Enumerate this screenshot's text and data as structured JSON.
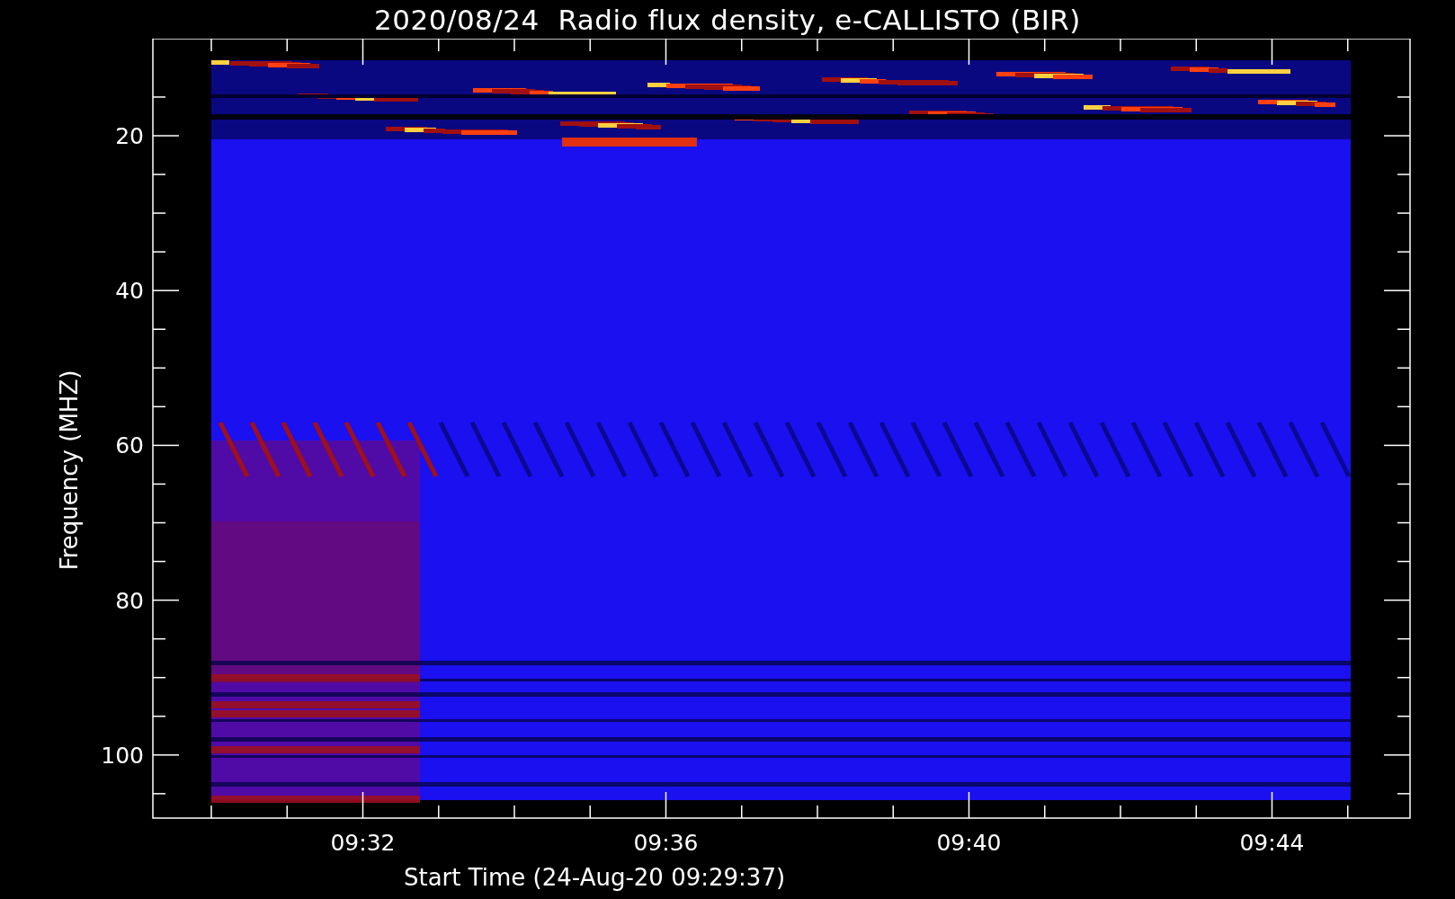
{
  "title": "2020/08/24  Radio flux density, e-CALLISTO (BIR)",
  "y_axis": {
    "title": "Frequency (MHZ)",
    "ticks": [
      "20",
      "40",
      "60",
      "80",
      "100"
    ]
  },
  "x_axis": {
    "title": "Start Time (24-Aug-20 09:29:37)",
    "ticks": [
      "09:32",
      "09:36",
      "09:40",
      "09:44"
    ]
  }
}
